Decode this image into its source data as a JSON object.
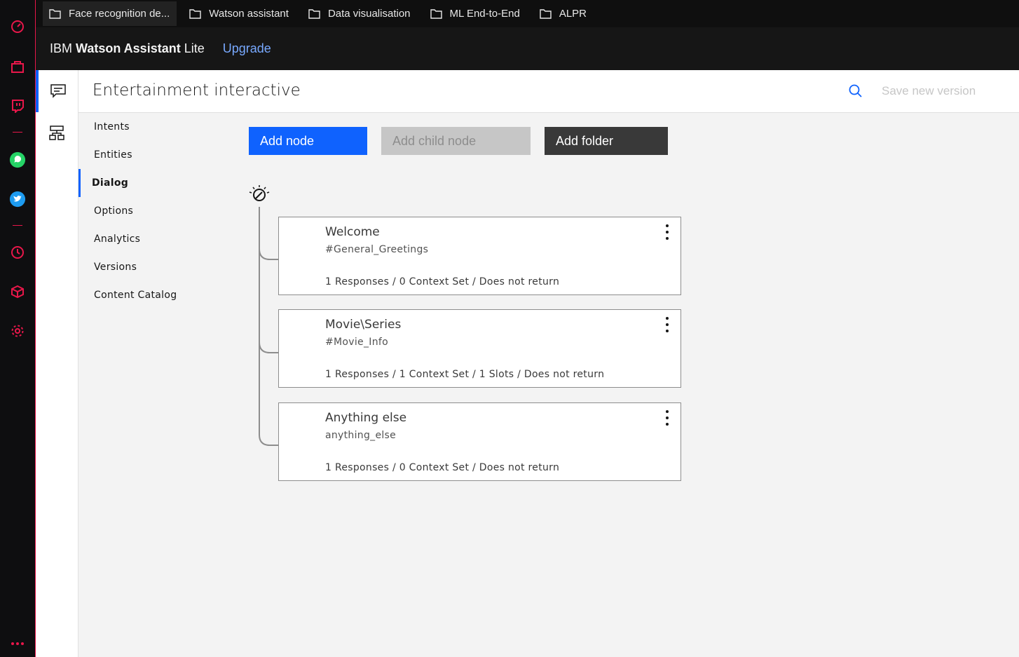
{
  "browser_sidebar": {
    "icons": [
      "speed-dial-icon",
      "bookmarks-icon",
      "twitch-icon",
      "whatsapp-icon",
      "twitter-icon",
      "history-icon",
      "extensions-icon",
      "settings-icon",
      "more-icon"
    ],
    "accent_color": "#e8174a"
  },
  "bookmarks": [
    {
      "label": "Face recognition de..."
    },
    {
      "label": "Watson assistant"
    },
    {
      "label": "Data visualisation"
    },
    {
      "label": "ML End-to-End"
    },
    {
      "label": "ALPR"
    }
  ],
  "header": {
    "brand_prefix": "IBM ",
    "brand_name": "Watson Assistant",
    "brand_plan": " Lite",
    "upgrade_label": "Upgrade"
  },
  "titlebar": {
    "title": "Entertainment interactive",
    "save_label": "Save new version"
  },
  "nav": {
    "items": [
      {
        "label": "Intents"
      },
      {
        "label": "Entities"
      },
      {
        "label": "Dialog"
      },
      {
        "label": "Options"
      },
      {
        "label": "Analytics"
      },
      {
        "label": "Versions"
      },
      {
        "label": "Content Catalog"
      }
    ],
    "active": "Dialog"
  },
  "toolbar": {
    "add_node": "Add node",
    "add_child_node": "Add child node",
    "add_folder": "Add folder"
  },
  "nodes": [
    {
      "title": "Welcome",
      "condition": "#General_Greetings",
      "meta": "1 Responses / 0 Context Set / Does not return"
    },
    {
      "title": "Movie\\Series",
      "condition": "#Movie_Info",
      "meta": "1 Responses / 1 Context Set / 1 Slots / Does not return"
    },
    {
      "title": "Anything else",
      "condition": "anything_else",
      "meta": "1 Responses / 0 Context Set / Does not return"
    }
  ],
  "colors": {
    "primary": "#0f62fe",
    "link": "#78a9ff"
  }
}
